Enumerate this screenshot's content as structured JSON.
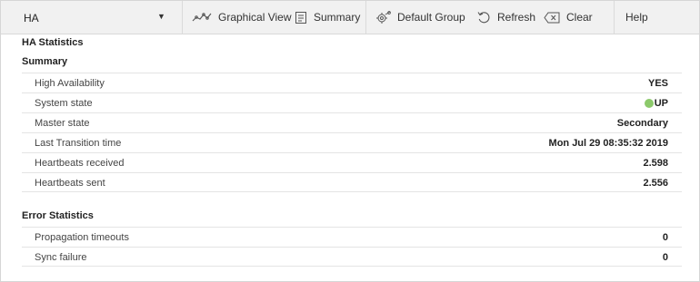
{
  "toolbar": {
    "dropdown_value": "HA",
    "buttons": [
      {
        "label": "Graphical View",
        "icon": "graph-icon"
      },
      {
        "label": "Summary",
        "icon": "document-icon"
      },
      {
        "label": "Default Group",
        "icon": "gear-group-icon"
      },
      {
        "label": "Refresh",
        "icon": "refresh-icon"
      },
      {
        "label": "Clear",
        "icon": "clear-icon"
      },
      {
        "label": "Help",
        "icon": ""
      }
    ]
  },
  "content": {
    "title": "HA Statistics",
    "summary": {
      "title": "Summary",
      "rows": [
        {
          "label": "High Availability",
          "value": "YES"
        },
        {
          "label": "System state",
          "value": "UP",
          "status_color": "#8cc96b"
        },
        {
          "label": "Master state",
          "value": "Secondary"
        },
        {
          "label": "Last Transition time",
          "value": "Mon Jul 29 08:35:32 2019"
        },
        {
          "label": "Heartbeats received",
          "value": "2.598"
        },
        {
          "label": "Heartbeats sent",
          "value": "2.556"
        }
      ]
    },
    "errors": {
      "title": "Error Statistics",
      "rows": [
        {
          "label": "Propagation timeouts",
          "value": "0"
        },
        {
          "label": "Sync failure",
          "value": "0"
        }
      ]
    }
  }
}
